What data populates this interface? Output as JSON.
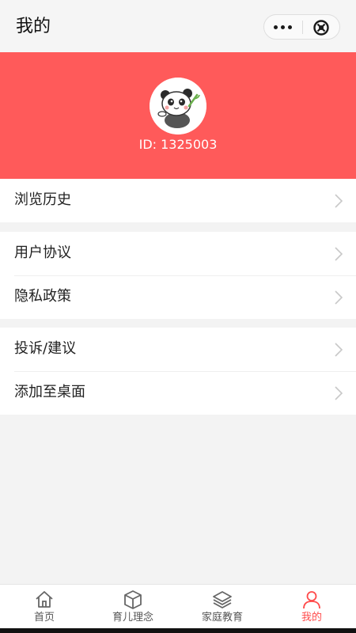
{
  "navbar": {
    "title": "我的",
    "more_icon": "more-dots-icon",
    "close_icon": "close-circle-icon"
  },
  "profile": {
    "id_text": "ID: 1325003",
    "avatar_icon": "panda-avatar",
    "header_color": "#ff5a5a"
  },
  "menu": {
    "group1": [
      {
        "label": "浏览历史"
      }
    ],
    "group2": [
      {
        "label": "用户协议"
      },
      {
        "label": "隐私政策"
      }
    ],
    "group3": [
      {
        "label": "投诉/建议"
      },
      {
        "label": "添加至桌面"
      }
    ]
  },
  "tabbar": {
    "tabs": [
      {
        "label": "首页",
        "icon": "home-icon"
      },
      {
        "label": "育儿理念",
        "icon": "cube-icon"
      },
      {
        "label": "家庭教育",
        "icon": "layers-icon"
      },
      {
        "label": "我的",
        "icon": "user-icon",
        "active": true
      }
    ],
    "active_color": "#ff4b4b"
  }
}
